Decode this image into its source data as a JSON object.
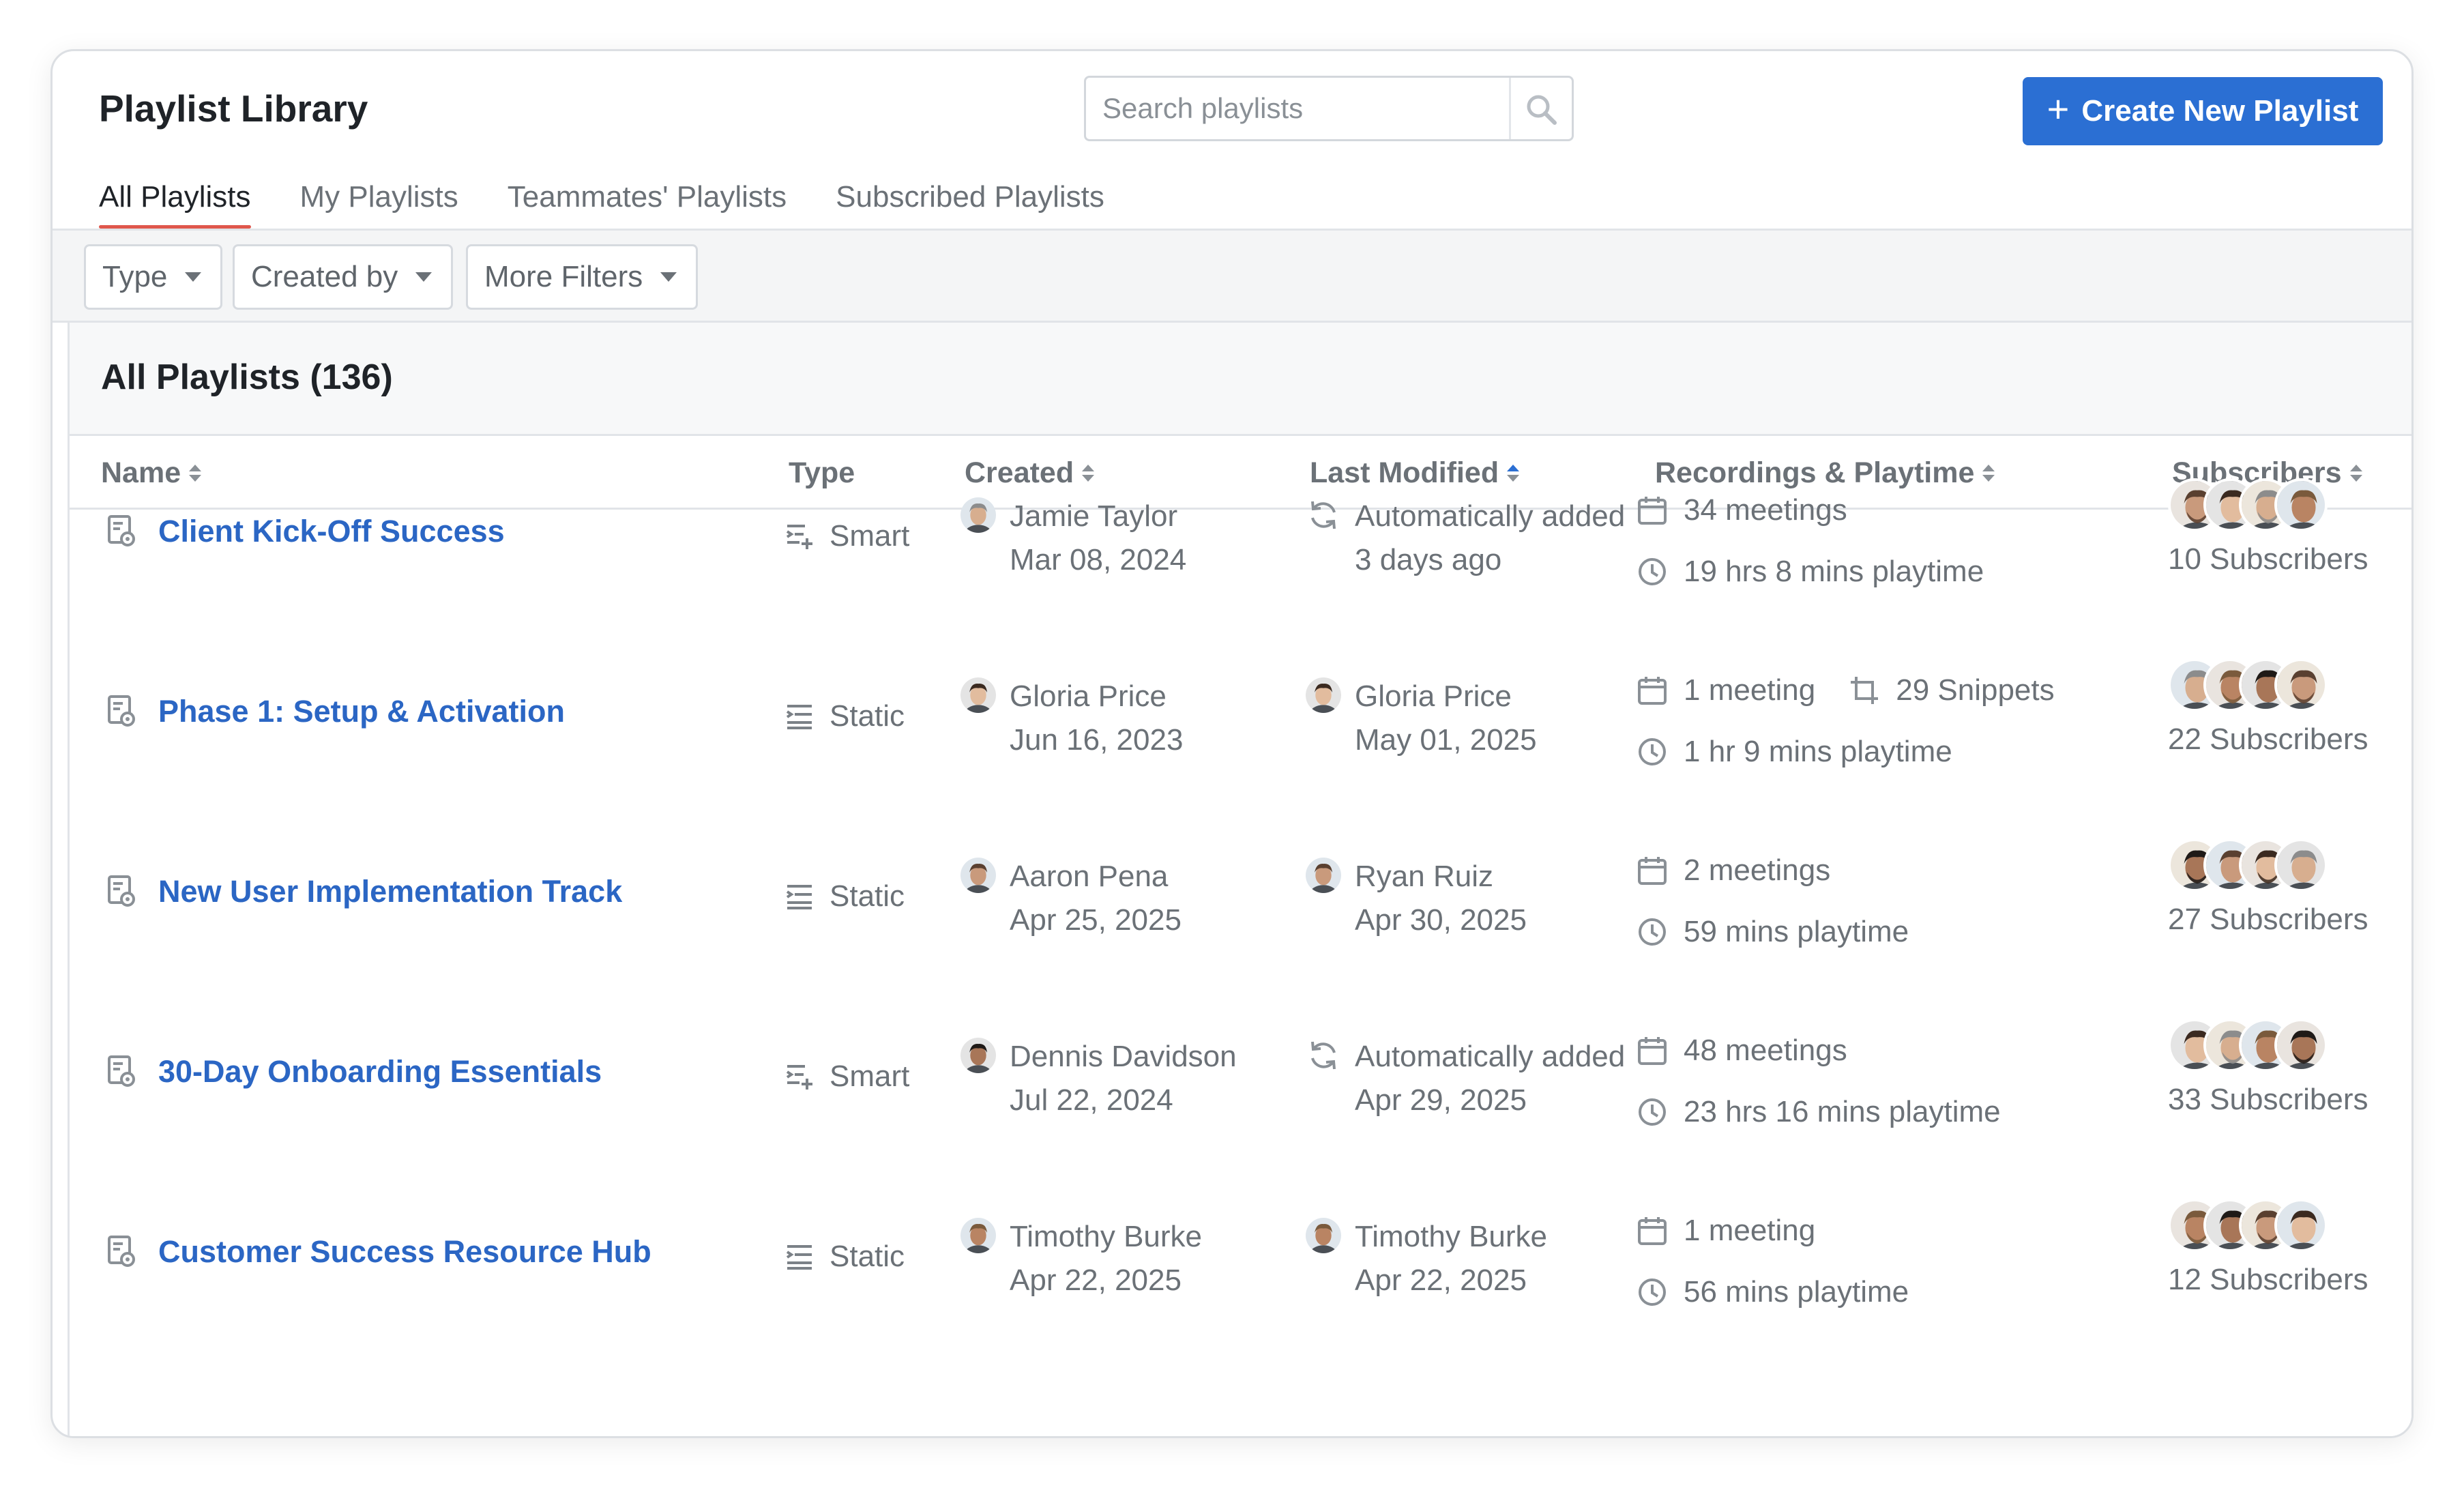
{
  "header": {
    "title": "Playlist Library",
    "search_placeholder": "Search playlists",
    "create_label": "Create New Playlist"
  },
  "tabs": [
    "All Playlists",
    "My Playlists",
    "Teammates' Playlists",
    "Subscribed Playlists"
  ],
  "filters": [
    "Type",
    "Created by",
    "More Filters"
  ],
  "list": {
    "title": "All Playlists (136)",
    "columns": [
      "Name",
      "Type",
      "Created",
      "Last Modified",
      "Recordings & Playtime",
      "Subscribers"
    ]
  },
  "rows": [
    {
      "name": "Client Kick-Off Success",
      "type": "Smart",
      "created_by": "Jamie Taylor",
      "created_date": "Mar 08, 2024",
      "modified_line1": "Automatically added",
      "modified_line2": "3 days ago",
      "meetings": "34 meetings",
      "snippets": "",
      "playtime": "19 hrs 8 mins playtime",
      "subscribers": "10 Subscribers"
    },
    {
      "name": "Phase 1: Setup & Activation",
      "type": "Static",
      "created_by": "Gloria Price",
      "created_date": "Jun 16, 2023",
      "modified_line1": "Gloria Price",
      "modified_line2": "May 01, 2025",
      "meetings": "1 meeting",
      "snippets": "29 Snippets",
      "playtime": "1 hr 9 mins playtime",
      "subscribers": "22 Subscribers"
    },
    {
      "name": "New User Implementation Track",
      "type": "Static",
      "created_by": "Aaron Pena",
      "created_date": "Apr 25, 2025",
      "modified_line1": "Ryan Ruiz",
      "modified_line2": "Apr 30, 2025",
      "meetings": "2 meetings",
      "snippets": "",
      "playtime": "59 mins playtime",
      "subscribers": "27 Subscribers"
    },
    {
      "name": "30-Day Onboarding Essentials",
      "type": "Smart",
      "created_by": "Dennis Davidson",
      "created_date": "Jul 22, 2024",
      "modified_line1": "Automatically added",
      "modified_line2": "Apr 29, 2025",
      "meetings": "48 meetings",
      "snippets": "",
      "playtime": "23 hrs 16 mins playtime",
      "subscribers": "33 Subscribers"
    },
    {
      "name": "Customer Success Resource Hub",
      "type": "Static",
      "created_by": "Timothy Burke",
      "created_date": "Apr 22, 2025",
      "modified_line1": "Timothy Burke",
      "modified_line2": "Apr 22, 2025",
      "meetings": "1 meeting",
      "snippets": "",
      "playtime": "56 mins playtime",
      "subscribers": "12 Subscribers"
    }
  ],
  "colors": {
    "accent": "#2b6fd3",
    "link": "#2b66c4",
    "tab_underline": "#e0574c",
    "muted_text": "#6b7177"
  }
}
